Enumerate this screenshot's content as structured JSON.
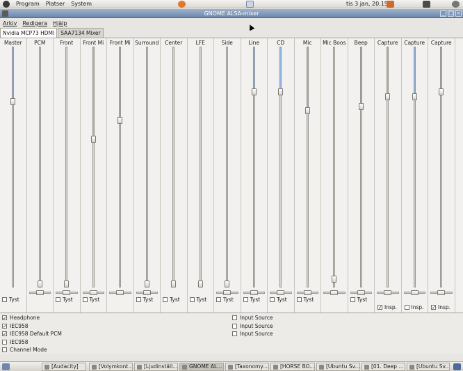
{
  "top_panel": {
    "menu": [
      "Program",
      "Platser",
      "System"
    ],
    "clock": "tis  3 jan, 20.15"
  },
  "window": {
    "title": "GNOME ALSA-mixer",
    "controls": [
      "_",
      "□",
      "×"
    ]
  },
  "menubar": [
    "Arkiv",
    "Redigera",
    "Hjälp"
  ],
  "tabs": [
    {
      "label": "Nvidia MCP73 HDMI",
      "active": true
    },
    {
      "label": "SAA7134 Mixer",
      "active": false
    }
  ],
  "colors": {
    "fill": "#8fb2e0",
    "titlebar": "#6d87ad"
  },
  "channels": [
    {
      "label": "Master",
      "level": 0.78,
      "balance": null,
      "mute": "Tyst",
      "mute_checked": false
    },
    {
      "label": "PCM",
      "level": 0.0,
      "balance": 0.5,
      "mute": null,
      "mute_checked": false
    },
    {
      "label": "Front",
      "level": 0.0,
      "balance": 0.5,
      "mute": "Tyst",
      "mute_checked": false
    },
    {
      "label": "Front Mi",
      "level": 0.62,
      "balance": 0.5,
      "mute": "Tyst",
      "mute_checked": false
    },
    {
      "label": "Front Mi",
      "level": 0.7,
      "balance": 0.5,
      "mute": null,
      "mute_checked": false
    },
    {
      "label": "Surround",
      "level": 0.0,
      "balance": 0.5,
      "mute": "Tyst",
      "mute_checked": false
    },
    {
      "label": "Center",
      "level": 0.0,
      "balance": null,
      "mute": "Tyst",
      "mute_checked": false
    },
    {
      "label": "LFE",
      "level": 0.0,
      "balance": null,
      "mute": "Tyst",
      "mute_checked": false
    },
    {
      "label": "Side",
      "level": 0.0,
      "balance": 0.5,
      "mute": "Tyst",
      "mute_checked": false
    },
    {
      "label": "Line",
      "level": 0.82,
      "balance": 0.5,
      "mute": "Tyst",
      "mute_checked": false
    },
    {
      "label": "CD",
      "level": 0.82,
      "balance": 0.5,
      "mute": "Tyst",
      "mute_checked": false
    },
    {
      "label": "Mic",
      "level": 0.74,
      "balance": 0.5,
      "mute": "Tyst",
      "mute_checked": false
    },
    {
      "label": "Mic Boos",
      "level": 0.02,
      "balance": 0.5,
      "mute": null,
      "mute_checked": false
    },
    {
      "label": "Beep",
      "level": 0.76,
      "balance": 0.5,
      "mute": "Tyst",
      "mute_checked": false
    },
    {
      "label": "Capture",
      "level": 0.8,
      "balance": 0.5,
      "mute": "Insp.",
      "mute_checked": true
    },
    {
      "label": "Capture",
      "level": 0.8,
      "balance": 0.5,
      "mute": "Insp.",
      "mute_checked": false
    },
    {
      "label": "Capture",
      "level": 0.82,
      "balance": 0.5,
      "mute": "Insp.",
      "mute_checked": true
    }
  ],
  "switches": [
    {
      "label": "Headphone",
      "checked": true
    },
    {
      "label": "IEC958",
      "checked": true
    },
    {
      "label": "IEC958 Default PCM",
      "checked": true
    },
    {
      "label": "IEC958",
      "checked": false
    },
    {
      "label": "Channel Mode",
      "checked": false
    }
  ],
  "selects": [
    {
      "label": "Input Source"
    },
    {
      "label": "Input Source"
    },
    {
      "label": "Input Source"
    }
  ],
  "taskbar": [
    {
      "label": "[Audacity]",
      "active": false
    },
    {
      "label": "[Volymkont...",
      "active": false
    },
    {
      "label": "[Ljudinställ...",
      "active": false
    },
    {
      "label": "GNOME AL...",
      "active": true
    },
    {
      "label": "[Taxonomy....",
      "active": false
    },
    {
      "label": "[HORSE BO...",
      "active": false
    },
    {
      "label": "[Ubuntu Sv...",
      "active": false
    },
    {
      "label": "[01. Deep ...",
      "active": false
    },
    {
      "label": "[Ubuntu Sv...",
      "active": false
    }
  ]
}
